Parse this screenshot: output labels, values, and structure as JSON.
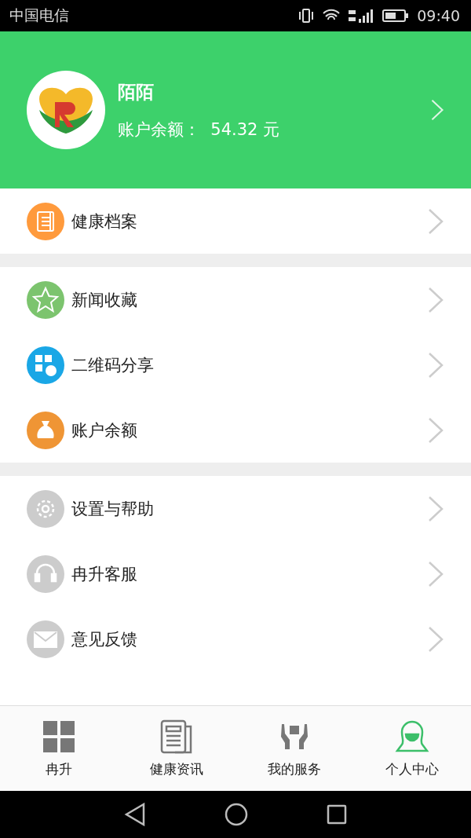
{
  "status_bar": {
    "carrier": "中国电信",
    "time": "09:40"
  },
  "profile": {
    "name": "陌陌",
    "balance_label": "账户余额：",
    "balance": "54.32",
    "unit": "元"
  },
  "menu_groups": [
    [
      {
        "kind": "record",
        "color": "#ff9a3c",
        "label": "健康档案"
      }
    ],
    [
      {
        "kind": "star",
        "color": "#7cc46e",
        "label": "新闻收藏"
      },
      {
        "kind": "qr",
        "color": "#1aa7e6",
        "label": "二维码分享"
      },
      {
        "kind": "moneybag",
        "color": "#ef9535",
        "label": "账户余额"
      }
    ],
    [
      {
        "kind": "gear",
        "color": "#cccccc",
        "label": "设置与帮助"
      },
      {
        "kind": "headset",
        "color": "#cccccc",
        "label": "冉升客服"
      },
      {
        "kind": "mail",
        "color": "#cccccc",
        "label": "意见反馈"
      }
    ]
  ],
  "tabs": [
    {
      "kind": "grid",
      "label": "冉升",
      "selected": false
    },
    {
      "kind": "news",
      "label": "健康资讯",
      "selected": false
    },
    {
      "kind": "hands",
      "label": "我的服务",
      "selected": false
    },
    {
      "kind": "person",
      "label": "个人中心",
      "selected": true
    }
  ]
}
